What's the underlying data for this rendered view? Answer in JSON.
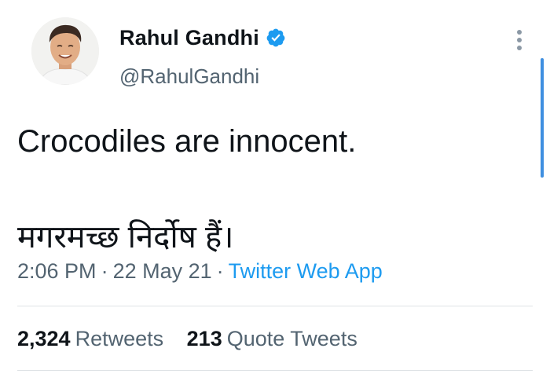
{
  "tweet": {
    "author": {
      "display_name": "Rahul Gandhi",
      "handle": "@RahulGandhi",
      "verified": true,
      "avatar": "profile-photo"
    },
    "text_lines": [
      "Crocodiles are innocent.",
      "मगरमच्छ निर्दोष हैं।"
    ],
    "time": "2:06 PM",
    "date": "22 May 21",
    "separator": "·",
    "source": "Twitter Web App",
    "stats": {
      "retweets_count": "2,324",
      "retweets_label": "Retweets",
      "quote_tweets_count": "213",
      "quote_tweets_label": "Quote Tweets"
    }
  },
  "icons": {
    "verified": "verified-badge-icon",
    "more": "more-vertical-icon"
  },
  "colors": {
    "accent": "#1d9bf0",
    "text_primary": "#0f1419",
    "text_secondary": "#536471",
    "divider": "#dfe3e6"
  }
}
